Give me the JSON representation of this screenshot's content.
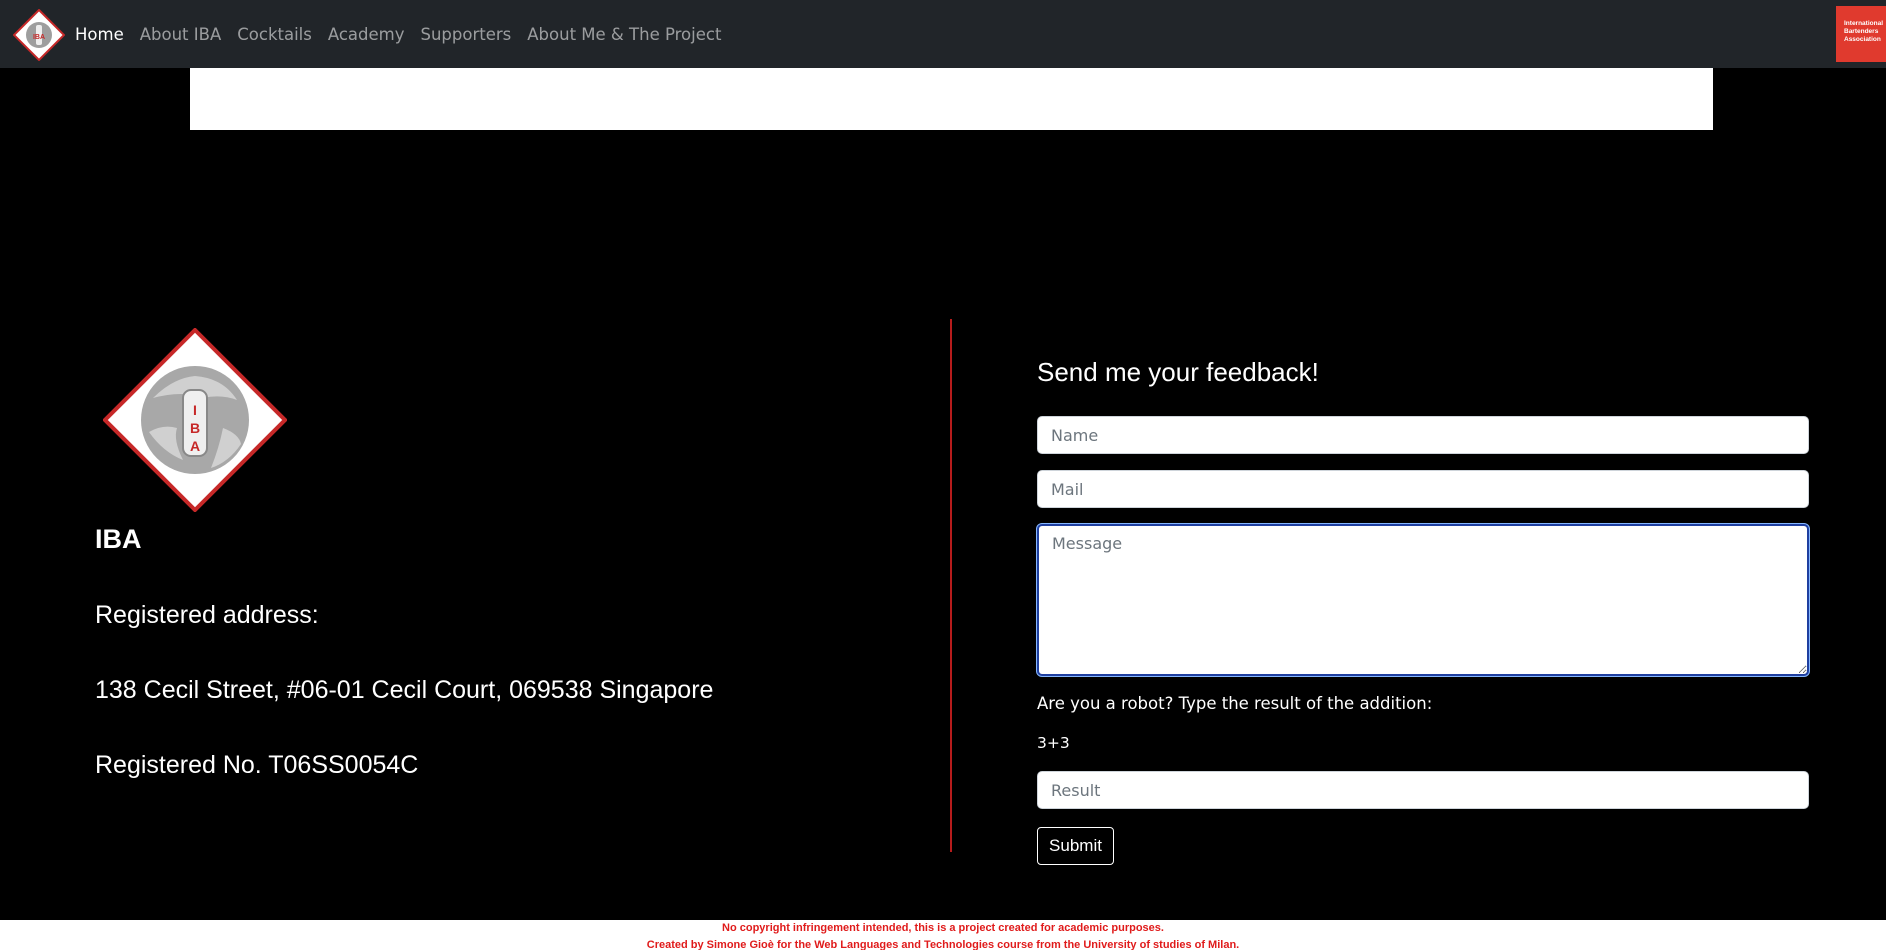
{
  "nav": {
    "brand_icon": "iba-logo-icon",
    "links": [
      "Home",
      "About IBA",
      "Cocktails",
      "Academy",
      "Supporters",
      "About Me & The Project"
    ],
    "badge_lines": [
      "International",
      "Bartenders",
      "Association"
    ]
  },
  "info": {
    "logo_letters": [
      "I",
      "B",
      "A"
    ],
    "org_name": "IBA",
    "address_label": "Registered address:",
    "address": "138 Cecil Street, #06-01 Cecil Court, 069538 Singapore",
    "registration": "Registered No. T06SS0054C"
  },
  "form": {
    "title": "Send me your feedback!",
    "name_placeholder": "Name",
    "mail_placeholder": "Mail",
    "message_placeholder": "Message",
    "robot_question": "Are you a robot? Type the result of the addition:",
    "sum": "3+3",
    "result_placeholder": "Result",
    "submit_label": "Submit"
  },
  "footer": {
    "line1": "No copyright infringement intended, this is a project created for academic purposes.",
    "line2": "Created by Simone Gioè for the Web Languages and Technologies course from the University of studies of Milan."
  },
  "colors": {
    "navbar": "#212529",
    "accent_red": "#e03a2e",
    "divider": "#b71c1c",
    "footer_text": "#e01b1b"
  }
}
